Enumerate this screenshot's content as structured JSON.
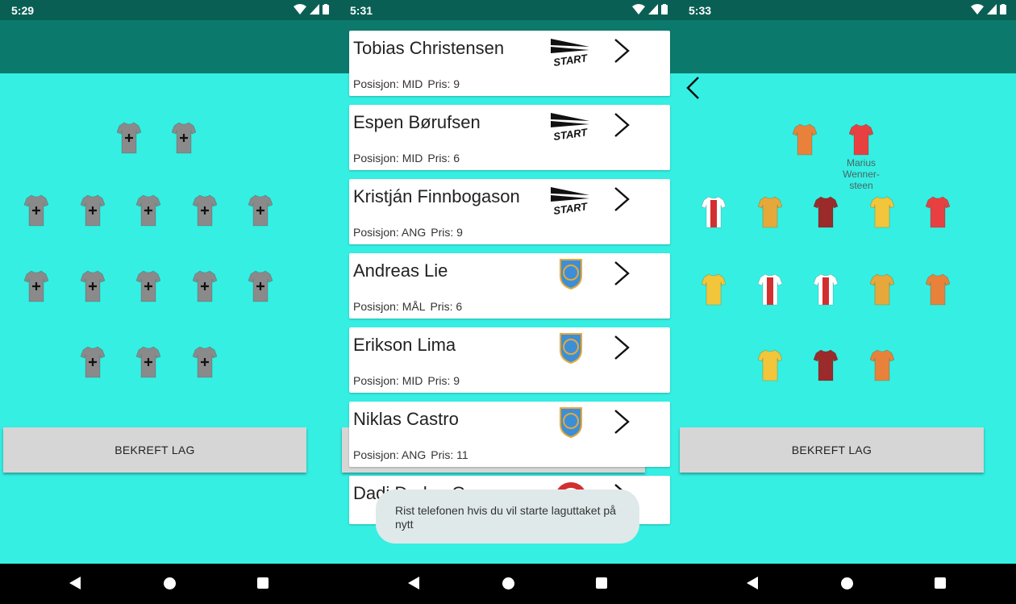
{
  "screens": [
    {
      "status_time": "5:29",
      "confirm_label": "BEKREFT LAG"
    },
    {
      "status_time": "5:31",
      "players": [
        {
          "name": "Tobias Christensen",
          "position_label": "Posisjon: MID",
          "price_label": "Pris: 9",
          "club_logo": "start-logo"
        },
        {
          "name": "Espen Børufsen",
          "position_label": "Posisjon: MID",
          "price_label": "Pris: 6",
          "club_logo": "start-logo"
        },
        {
          "name": "Kristján Finnbogason",
          "position_label": "Posisjon: ANG",
          "price_label": "Pris: 9",
          "club_logo": "start-logo"
        },
        {
          "name": "Andreas Lie",
          "position_label": "Posisjon: MÅL",
          "price_label": "Pris: 6",
          "club_logo": "aafk-logo"
        },
        {
          "name": "Erikson Lima",
          "position_label": "Posisjon: MID",
          "price_label": "Pris: 9",
          "club_logo": "aafk-logo"
        },
        {
          "name": "Niklas Castro",
          "position_label": "Posisjon: ANG",
          "price_label": "Pris: 11",
          "club_logo": "aafk-logo"
        },
        {
          "name": "Dadi Dodou Gaye",
          "club_logo": "lillestrom-logo"
        }
      ],
      "toast": "Rist telefonen hvis du vil starte laguttaket på nytt"
    },
    {
      "status_time": "5:33",
      "selected_player_label": "Marius Wenner-steen",
      "confirm_label": "BEKREFT LAG"
    }
  ],
  "colors": {
    "pitch": "#35efe3",
    "statusbar": "#0a5f55",
    "appbar": "#0b7a6d",
    "empty_shirt": "#8a8a8a",
    "button": "#d6d6d6"
  }
}
